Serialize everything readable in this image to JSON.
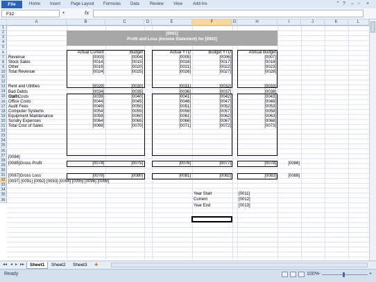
{
  "ribbon": {
    "file_label": "File",
    "tabs": [
      "Home",
      "Insert",
      "Page Layout",
      "Formulas",
      "Data",
      "Review",
      "View",
      "Add-Ins"
    ]
  },
  "formula_bar": {
    "name_box": "F32",
    "fx_label": "fx",
    "formula": ""
  },
  "columns": [
    "A",
    "B",
    "C",
    "D",
    "E",
    "F",
    "G",
    "H",
    "I",
    "J",
    "K",
    "L"
  ],
  "rows": [
    "1",
    "2",
    "3",
    "4",
    "5",
    "6",
    "7",
    "8",
    "9",
    "10",
    "11",
    "12",
    "13",
    "14",
    "15",
    "16",
    "17",
    "18",
    "19",
    "20",
    "21",
    "22",
    "23",
    "24",
    "25",
    "26",
    "27",
    "28",
    "29",
    "30",
    "31",
    "32",
    "33",
    "34",
    "35",
    "36"
  ],
  "sheet": {
    "banner_line1": "[0001]",
    "banner_line2": "Profit and Loss (Income Statement) for [0002]",
    "headers": {
      "actual_current": "Actual Current",
      "budget": "Budget",
      "actual_ytd": "Actual YTD",
      "budget_ytd": "Budget YTD",
      "annual_budget": "Annual Budget"
    },
    "revenue_rows": [
      {
        "label": "Revenue",
        "b": "[0003]",
        "c": "[0004]",
        "e": "[0005]",
        "f": "[0006]",
        "h": "[0007]"
      },
      {
        "label": "Stock Sales",
        "b": "[0014]",
        "c": "[0015]",
        "e": "[0016]",
        "f": "[0017]",
        "h": "[0018]"
      },
      {
        "label": "Other",
        "b": "[0019]",
        "c": "[0020]",
        "e": "[0021]",
        "f": "[0022]",
        "h": "[0023]"
      },
      {
        "label": "Total Revenue",
        "b": "[0024]",
        "c": "[0025]",
        "e": "[0026]",
        "f": "[0027]",
        "h": "[0028]"
      }
    ],
    "costs_label": "Costs",
    "cost_rows": [
      {
        "label": "Rent and Utilities",
        "b": "[0029]",
        "c": "[0030]",
        "e": "[0031]",
        "f": "[0032]",
        "h": "[0033]"
      },
      {
        "label": "Bad Debts",
        "b": "[0034]",
        "c": "[0035]",
        "e": "[0036]",
        "f": "[0037]",
        "h": "[0038]"
      },
      {
        "label": "Staff Costs",
        "b": "[0039]",
        "c": "[0040]",
        "e": "[0041]",
        "f": "[0042]",
        "h": "[0043]"
      },
      {
        "label": "Office Costs",
        "b": "[0044]",
        "c": "[0045]",
        "e": "[0046]",
        "f": "[0047]",
        "h": "[0048]"
      },
      {
        "label": "Audit Fees",
        "b": "[0049]",
        "c": "[0050]",
        "e": "[0051]",
        "f": "[0052]",
        "h": "[0053]"
      },
      {
        "label": "Computer Systems",
        "b": "[0054]",
        "c": "[0055]",
        "e": "[0056]",
        "f": "[0057]",
        "h": "[0058]"
      },
      {
        "label": "Equipment Maintenance",
        "b": "[0059]",
        "c": "[0060]",
        "e": "[0061]",
        "f": "[0062]",
        "h": "[0063]"
      },
      {
        "label": "Sundry Expenses",
        "b": "[0064]",
        "c": "[0065]",
        "e": "[0066]",
        "f": "[0067]",
        "h": "[0068]"
      },
      {
        "label": "Total Cost of Sales",
        "b": "[0069]",
        "c": "[0070]",
        "e": "[0071]",
        "f": "[0072]",
        "h": "[0073]"
      }
    ],
    "row22": "[0084]",
    "gross_profit": {
      "label": "[0085]Gross Profit",
      "b": "[0074]",
      "c": "[0075]",
      "e": "[0076]",
      "f": "[0077]",
      "h": "[0078]",
      "i": "[0086]"
    },
    "gross_loss": {
      "label": "[0087]Gross Loss",
      "b": "[0079]",
      "c": "[0080]",
      "e": "[0081]",
      "f": "[0082]",
      "h": "[0083]",
      "i": "[0088]"
    },
    "row26": "[0097] [0091] [0092] [0093] [0094] [0095] [0096] [0098]",
    "info": [
      {
        "label": "Year Start",
        "value": "[0011]"
      },
      {
        "label": "Current",
        "value": "[0012]"
      },
      {
        "label": "Year End",
        "value": "[0013]"
      }
    ]
  },
  "sheet_tabs": [
    "Sheet1",
    "Sheet2",
    "Sheet3"
  ],
  "status": {
    "ready": "Ready",
    "zoom": "100%",
    "minus": "−",
    "plus": "+"
  }
}
